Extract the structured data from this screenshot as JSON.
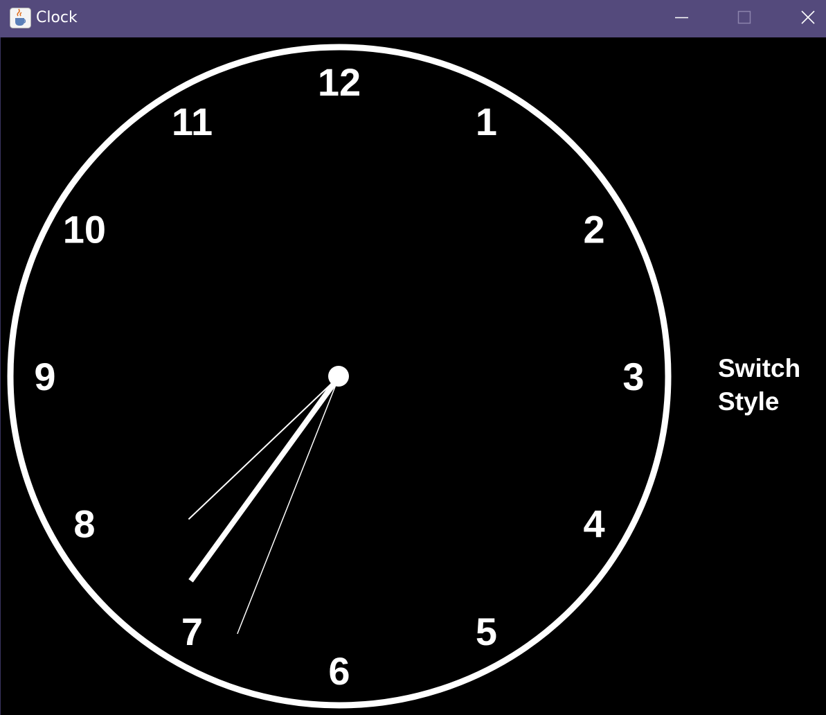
{
  "window": {
    "title": "Clock",
    "icon": "java-coffee-cup-icon",
    "controls": {
      "minimize": "minimize-icon",
      "maximize": "maximize-icon",
      "close": "close-icon"
    },
    "colors": {
      "titlebar": "#544a7c",
      "background": "#000000",
      "foreground": "#ffffff"
    }
  },
  "clock": {
    "numerals": [
      "12",
      "1",
      "2",
      "3",
      "4",
      "5",
      "6",
      "7",
      "8",
      "9",
      "10",
      "11"
    ],
    "time": {
      "hour": 7,
      "minute": 33,
      "second": 36
    }
  },
  "switch_button": {
    "line1": "Switch",
    "line2": "Style"
  }
}
